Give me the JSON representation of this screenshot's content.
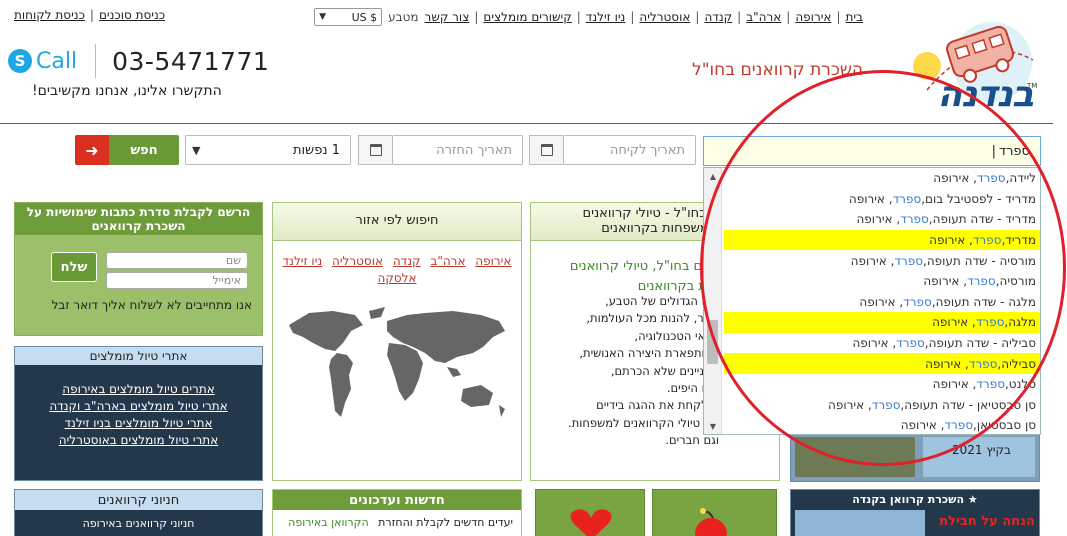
{
  "topnav": {
    "items": [
      "בית",
      "אירופה",
      "ארה\"ב",
      "קנדה",
      "אוסטרליה",
      "ניו זילנד",
      "קישורים מומלצים",
      "צור קשר"
    ],
    "currency_label": "מטבע",
    "currency_value": "US $"
  },
  "loginnav": {
    "items": [
      "כניסת לקוחות",
      "כניסת סוכנים"
    ]
  },
  "header": {
    "skype_letter": "S",
    "call_label": "Call",
    "phone": "03-5471771",
    "contact_text": "התקשרו אלינו, אנחנו מקשיבים!",
    "tagline": "השכרת קרוואנים בחו\"ל",
    "logo_text": "בנדנה",
    "logo_tm": "TM"
  },
  "search": {
    "destination_value": "ספרד",
    "pickup_placeholder": "תאריך לקיחה",
    "return_placeholder": "תאריך החזרה",
    "passengers_value": "1 נפשות",
    "search_label": "חפש",
    "arrow_glyph": "➜"
  },
  "autocomplete": {
    "items": [
      {
        "pre": "ליידה, ",
        "hit": "ספרד",
        "post": ", אירופה",
        "highlight": false
      },
      {
        "pre": "מדריד - לפסטיבל בום, ",
        "hit": "ספרד",
        "post": ", אירופה",
        "highlight": false
      },
      {
        "pre": "מדריד - שדה תעופה, ",
        "hit": "ספרד",
        "post": ", אירופה",
        "highlight": false
      },
      {
        "pre": "מדריד, ",
        "hit": "ספרד",
        "post": ", אירופה",
        "highlight": true
      },
      {
        "pre": "מורסיה - שדה תעופה, ",
        "hit": "ספרד",
        "post": ", אירופה",
        "highlight": false
      },
      {
        "pre": "מורסיה, ",
        "hit": "ספרד",
        "post": ", אירופה",
        "highlight": false
      },
      {
        "pre": "מלגה - שדה תעופה, ",
        "hit": "ספרד",
        "post": ", אירופה",
        "highlight": false
      },
      {
        "pre": "מלגה, ",
        "hit": "ספרד",
        "post": ", אירופה",
        "highlight": true
      },
      {
        "pre": "סביליה - שדה תעופה, ",
        "hit": "ספרד",
        "post": ", אירופה",
        "highlight": false
      },
      {
        "pre": "סביליה, ",
        "hit": "ספרד",
        "post": ", אירופה",
        "highlight": true
      },
      {
        "pre": "סלנט, ",
        "hit": "ספרד",
        "post": ", אירופה",
        "highlight": false
      },
      {
        "pre": "סן סבסטיאן - שדה תעופה, ",
        "hit": "ספרד",
        "post": ", אירופה",
        "highlight": false
      },
      {
        "pre": "סן סבסטיאן, ",
        "hit": "ספרד",
        "post": ", אירופה",
        "highlight": false
      }
    ]
  },
  "register": {
    "title": "הרשם לקבלת סדרת כתבות שימושיות על השכרת קרוואנים",
    "name_placeholder": "שם",
    "email_placeholder": "אימייל",
    "send_label": "שלח",
    "note": "אנו מתחייבים לא לשלוח אליך דואר זבל"
  },
  "recommended": {
    "title": "אתרי טיול מומלצים",
    "links": [
      "אתרים טיול מומלצים באירופה",
      "אתרי טיול מומלצים בארה\"ב וקנדה",
      "אתרי טיול מומלצים בניו זילנד",
      "אתרי טיול מומלצים באוסטרליה"
    ]
  },
  "shops": {
    "title": "חניוני קרוואנים",
    "preview": "חניוני קרוואנים באירופה"
  },
  "region": {
    "title": "חיפוש לפי אזור",
    "links": [
      "אירופה",
      "ארה\"ב",
      "קנדה",
      "אוסטרליה",
      "ניו זילנד",
      "אלסקה"
    ]
  },
  "trips": {
    "title_line1": "נים בחו\"ל - טיולי קרוואנים",
    "title_line2": "משפחות בקרוואנים",
    "green_line1": "אנים בחו\"ל, טיולי קרוואנים",
    "green_line2": "חות בקרוואנים",
    "body_lines": [
      "עים הגדולים של הטבע,",
      "אחר, להנות מכל העולמות,",
      "פלאי הטכנולוגיה,",
      "ות ותפארת היצירה האנושית,",
      "מעניינים שלא הכרתם,",
      "עים היפים.",
      "ם לקחת את ההגה בידיים",
      "את טיולי הקרוואנים למשפחות.",
      "וגם חברים."
    ]
  },
  "news": {
    "title": "חדשות ועדכונים",
    "line_left": "הקרוואן באירופה",
    "line_right": "יעדים חדשים לקבלת והחזרת"
  },
  "canada": {
    "title": "השכרת קרוואן בקנדה",
    "star": "★",
    "promo": "הנחה על חבילת",
    "season": "בקיץ 2021"
  }
}
